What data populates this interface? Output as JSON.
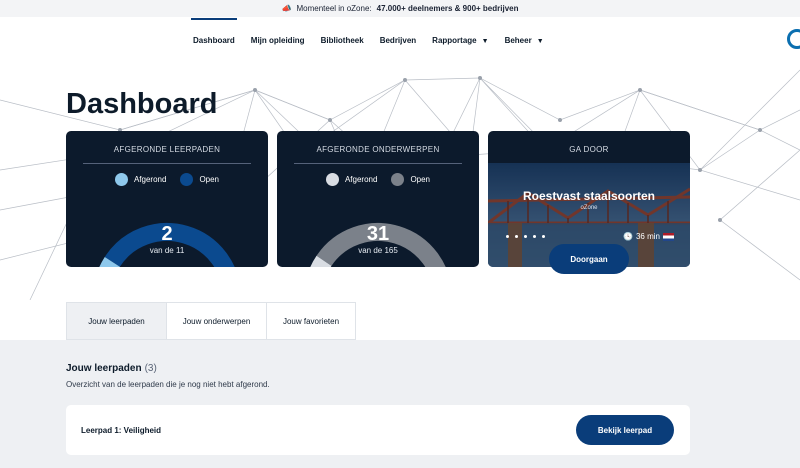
{
  "announcement": {
    "prefix": "Momenteel in oZone:",
    "highlight": "47.000+ deelnemers & 900+ bedrijven"
  },
  "nav": {
    "items": [
      {
        "label": "Dashboard"
      },
      {
        "label": "Mijn opleiding"
      },
      {
        "label": "Bibliotheek"
      },
      {
        "label": "Bedrijven"
      },
      {
        "label": "Rapportage"
      },
      {
        "label": "Beheer"
      }
    ]
  },
  "page": {
    "title": "Dashboard"
  },
  "cards": {
    "paths": {
      "title": "AFGERONDE LEERPADEN",
      "legend_done": "Afgerond",
      "legend_open": "Open",
      "value": "2",
      "sub": "van de 11",
      "done": 2,
      "total": 11,
      "color_done": "#8ec8ec",
      "color_open": "#0b4a8f"
    },
    "topics": {
      "title": "AFGERONDE ONDERWERPEN",
      "legend_done": "Afgerond",
      "legend_open": "Open",
      "value": "31",
      "sub": "van de 165",
      "done": 31,
      "total": 165,
      "color_done": "#d9dde3",
      "color_open": "#7b818a"
    },
    "continue": {
      "title": "GA DOOR",
      "course_title": "Roestvast staalsoorten",
      "course_sub": "oZone",
      "duration": "36 min",
      "button": "Doorgaan"
    }
  },
  "tabs": [
    {
      "label": "Jouw leerpaden"
    },
    {
      "label": "Jouw onderwerpen"
    },
    {
      "label": "Jouw favorieten"
    }
  ],
  "section": {
    "title": "Jouw leerpaden",
    "count": "(3)",
    "description": "Overzicht van de leerpaden die je nog niet hebt afgerond.",
    "row_name": "Leerpad 1: Veiligheid",
    "row_button": "Bekijk leerpad"
  },
  "colors": {
    "accent": "#0a3d7a",
    "card_bg": "#0c1a2c"
  }
}
